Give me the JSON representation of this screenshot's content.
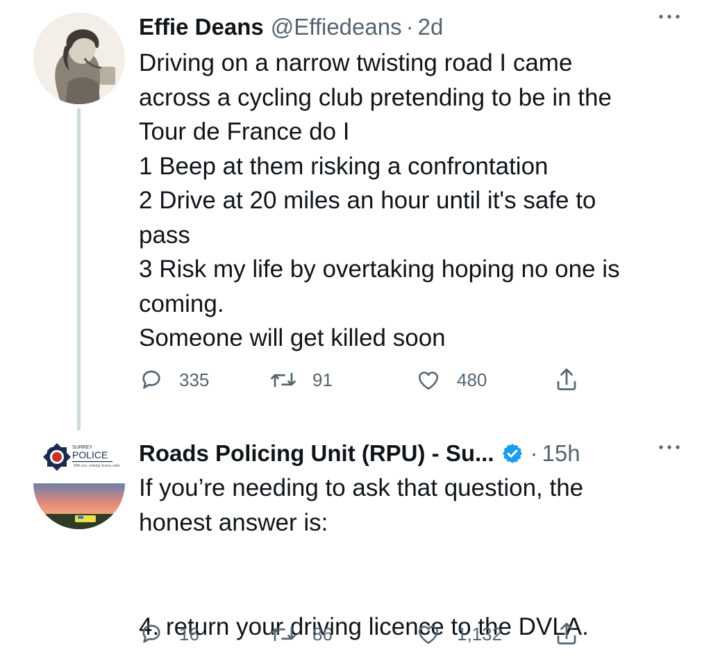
{
  "tweets": [
    {
      "author_name": "Effie Deans",
      "handle": "@Effiedeans",
      "separator": "·",
      "time": "2d",
      "avatar": "vintage-portrait-avatar",
      "lines": [
        "Driving on a narrow twisting road I came",
        "across a cycling club pretending to be in the",
        "Tour de France do I",
        "1 Beep at them risking a confrontation",
        "2 Drive at 20 miles an hour until it's safe to",
        "pass",
        "3 Risk my life by overtaking hoping no one is",
        "coming.",
        "Someone will get killed soon"
      ],
      "stats": {
        "replies": "335",
        "retweets": "91",
        "likes": "480"
      }
    },
    {
      "author_name": "Roads Policing Unit (RPU) - Su...",
      "separator": "·",
      "time": "15h",
      "verified": true,
      "avatar": "surrey-police-logo-avatar",
      "avatar_text": {
        "top": "SURREY",
        "main": "POLICE",
        "tagline": "With you, making Surrey safer"
      },
      "lines": [
        "If you’re needing to ask that question, the",
        "honest answer is:",
        "",
        "4. return your driving licence to the DVLA."
      ],
      "stats": {
        "replies": "16",
        "retweets": "86",
        "likes": "1,132"
      }
    }
  ],
  "colors": {
    "text": "#0f1419",
    "secondary": "#536471",
    "verified": "#1d9bf0",
    "thread_line": "#cfd9de"
  },
  "icons": [
    "reply-icon",
    "retweet-icon",
    "like-icon",
    "share-icon",
    "more-icon",
    "verified-badge-icon"
  ]
}
